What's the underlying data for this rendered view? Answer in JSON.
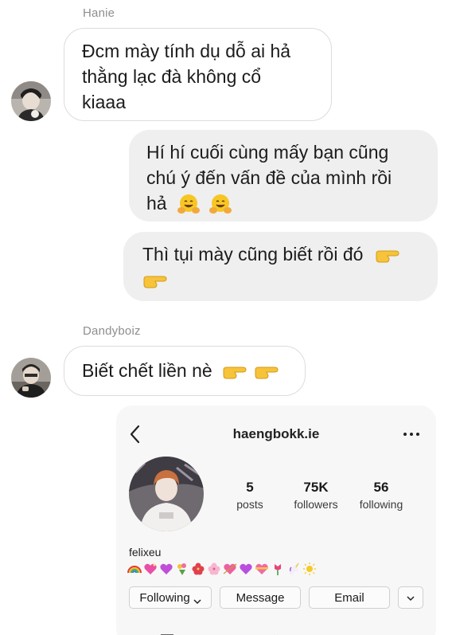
{
  "messages": [
    {
      "sender": "Hanie",
      "text_lines": [
        "Đcm mày tính dụ dỗ ai hả",
        "thằng lạc đà không cổ",
        "kiaaa"
      ]
    },
    {
      "sender": "me",
      "text_lines": [
        "Hí hí cuối cùng mấy bạn cũng",
        "chú ý đến vấn đề của mình rồi",
        "hả"
      ],
      "emojis": [
        "hugging-face",
        "hugging-face"
      ]
    },
    {
      "sender": "me",
      "text_lines": [
        "Thì tụi mày cũng biết rồi đó"
      ],
      "emojis": [
        "pointing-right",
        "pointing-right"
      ]
    },
    {
      "sender": "Dandyboiz",
      "text_lines": [
        "Biết chết liền nè"
      ],
      "emojis": [
        "pointing-right",
        "pointing-right"
      ]
    }
  ],
  "profile_card": {
    "username": "haengbokk.ie",
    "stats": [
      {
        "value": "5",
        "label": "posts"
      },
      {
        "value": "75K",
        "label": "followers"
      },
      {
        "value": "56",
        "label": "following"
      }
    ],
    "display_name": "felixeu",
    "bio_emojis": [
      "rainbow",
      "sparkling-heart",
      "purple-heart",
      "bouquet",
      "hibiscus",
      "cherry-blossom",
      "heart-arrow",
      "purple-heart",
      "ribbon-heart",
      "tulip",
      "unicorn",
      "sun"
    ],
    "buttons": {
      "following": "Following",
      "message": "Message",
      "email": "Email"
    }
  },
  "colors": {
    "incoming_bubble_border": "#dcdcdc",
    "outgoing_bubble_bg": "#efefef",
    "sender_name": "#8e8e8e",
    "card_bg": "#f7f7f7"
  }
}
